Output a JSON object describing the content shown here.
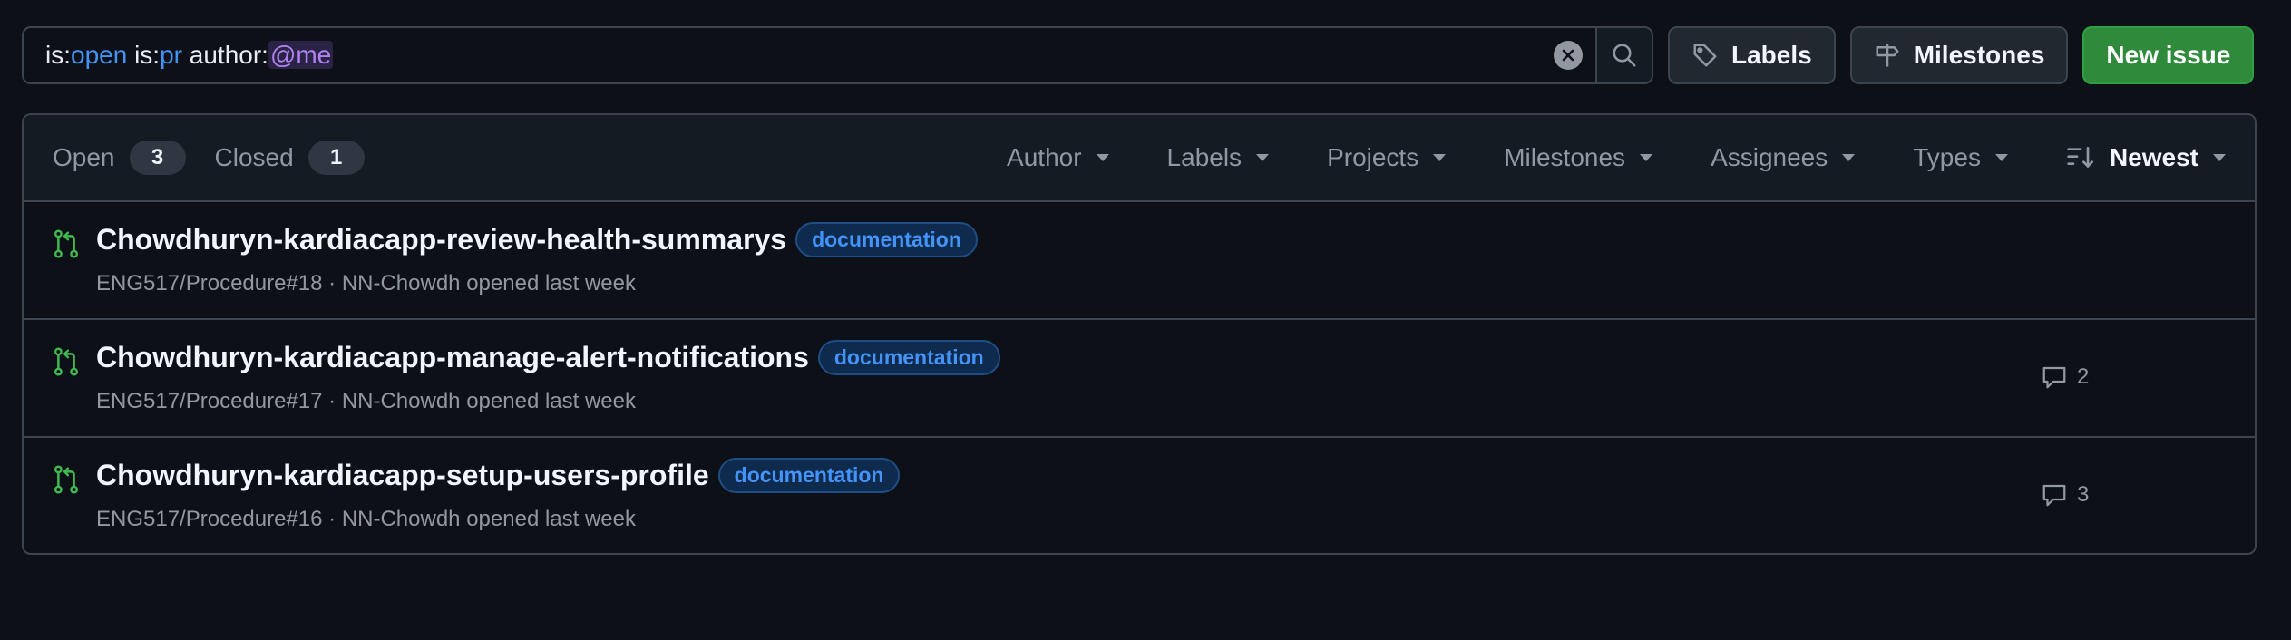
{
  "search": {
    "parts": [
      {
        "key": "is:",
        "value": "open"
      },
      {
        "key": " is:",
        "value": "pr"
      },
      {
        "key": " author:",
        "value": "@me"
      }
    ]
  },
  "toolbar": {
    "labels_label": "Labels",
    "milestones_label": "Milestones",
    "new_issue_label": "New issue"
  },
  "states": {
    "open": {
      "label": "Open",
      "count": "3"
    },
    "closed": {
      "label": "Closed",
      "count": "1"
    }
  },
  "filters": {
    "author": "Author",
    "labels": "Labels",
    "projects": "Projects",
    "milestones": "Milestones",
    "assignees": "Assignees",
    "types": "Types",
    "sort": "Newest"
  },
  "items": [
    {
      "title": "Chowdhuryn-kardiacapp-review-health-summarys",
      "label": "documentation",
      "meta": "ENG517/Procedure#18 · NN-Chowdh opened last week",
      "comments": ""
    },
    {
      "title": "Chowdhuryn-kardiacapp-manage-alert-notifications",
      "label": "documentation",
      "meta": "ENG517/Procedure#17 · NN-Chowdh opened last week",
      "comments": "2"
    },
    {
      "title": "Chowdhuryn-kardiacapp-setup-users-profile",
      "label": "documentation",
      "meta": "ENG517/Procedure#16 · NN-Chowdh opened last week",
      "comments": "3"
    }
  ],
  "colors": {
    "background": "#0d1117",
    "accent_blue": "#4493f8",
    "pr_open_green": "#3fb950",
    "primary_button": "#2f8a3b"
  },
  "icons": {
    "clear": "x-circle-fill-icon",
    "search": "search-icon",
    "labels": "tag-icon",
    "milestones": "milestone-icon",
    "sort": "sort-desc-icon",
    "pr": "git-pull-request-icon",
    "comment": "comment-icon"
  }
}
